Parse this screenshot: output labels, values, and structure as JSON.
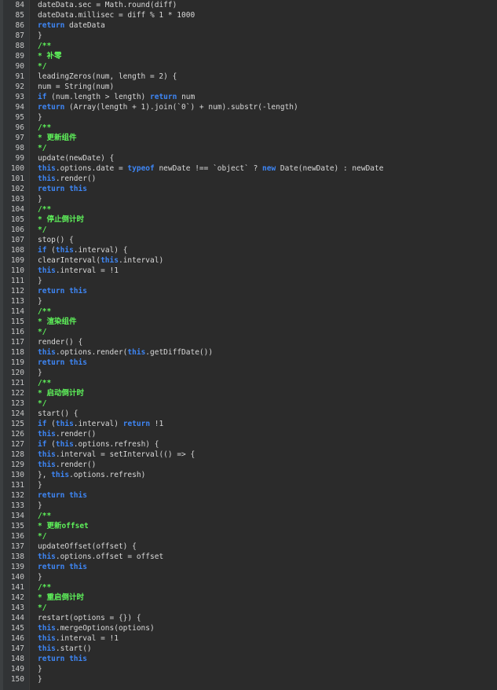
{
  "theme": {
    "background": "#2b2b2b",
    "gutter": "#313335",
    "keyword": "#3e86f5",
    "comment": "#5ef15a",
    "text": "#d9d9d9"
  },
  "lines": [
    {
      "n": "84",
      "tokens": [
        [
          "p",
          "dateData.sec = Math.round(diff)"
        ]
      ]
    },
    {
      "n": "85",
      "tokens": [
        [
          "p",
          "dateData.millisec = diff % 1 * 1000"
        ]
      ]
    },
    {
      "n": "86",
      "tokens": [
        [
          "k",
          "return"
        ],
        [
          "p",
          " dateData"
        ]
      ]
    },
    {
      "n": "87",
      "tokens": [
        [
          "p",
          "}"
        ]
      ]
    },
    {
      "n": "88",
      "tokens": [
        [
          "c",
          "/**"
        ]
      ]
    },
    {
      "n": "89",
      "tokens": [
        [
          "c",
          "* 补零"
        ]
      ]
    },
    {
      "n": "90",
      "tokens": [
        [
          "c",
          "*/"
        ]
      ]
    },
    {
      "n": "91",
      "tokens": [
        [
          "p",
          "leadingZeros(num, length = 2) {"
        ]
      ]
    },
    {
      "n": "92",
      "tokens": [
        [
          "p",
          "num = String(num)"
        ]
      ]
    },
    {
      "n": "93",
      "tokens": [
        [
          "k",
          "if"
        ],
        [
          "p",
          " (num.length > length) "
        ],
        [
          "k",
          "return"
        ],
        [
          "p",
          " num"
        ]
      ]
    },
    {
      "n": "94",
      "tokens": [
        [
          "k",
          "return"
        ],
        [
          "p",
          " (Array(length + 1).join(`0`) + num).substr(-length)"
        ]
      ]
    },
    {
      "n": "95",
      "tokens": [
        [
          "p",
          "}"
        ]
      ]
    },
    {
      "n": "96",
      "tokens": [
        [
          "c",
          "/**"
        ]
      ]
    },
    {
      "n": "97",
      "tokens": [
        [
          "c",
          "* 更新组件"
        ]
      ]
    },
    {
      "n": "98",
      "tokens": [
        [
          "c",
          "*/"
        ]
      ]
    },
    {
      "n": "99",
      "tokens": [
        [
          "p",
          "update(newDate) {"
        ]
      ]
    },
    {
      "n": "100",
      "tokens": [
        [
          "k",
          "this"
        ],
        [
          "p",
          ".options.date = "
        ],
        [
          "k",
          "typeof"
        ],
        [
          "p",
          " newDate !== `object` ? "
        ],
        [
          "k",
          "new"
        ],
        [
          "p",
          " Date(newDate) : newDate"
        ]
      ]
    },
    {
      "n": "101",
      "tokens": [
        [
          "k",
          "this"
        ],
        [
          "p",
          ".render()"
        ]
      ]
    },
    {
      "n": "102",
      "tokens": [
        [
          "k",
          "return"
        ],
        [
          "p",
          " "
        ],
        [
          "k",
          "this"
        ]
      ]
    },
    {
      "n": "103",
      "tokens": [
        [
          "p",
          "}"
        ]
      ]
    },
    {
      "n": "104",
      "tokens": [
        [
          "c",
          "/**"
        ]
      ]
    },
    {
      "n": "105",
      "tokens": [
        [
          "c",
          "* 停止倒计时"
        ]
      ]
    },
    {
      "n": "106",
      "tokens": [
        [
          "c",
          "*/"
        ]
      ]
    },
    {
      "n": "107",
      "tokens": [
        [
          "p",
          "stop() {"
        ]
      ]
    },
    {
      "n": "108",
      "tokens": [
        [
          "k",
          "if"
        ],
        [
          "p",
          " ("
        ],
        [
          "k",
          "this"
        ],
        [
          "p",
          ".interval) {"
        ]
      ]
    },
    {
      "n": "109",
      "tokens": [
        [
          "p",
          "clearInterval("
        ],
        [
          "k",
          "this"
        ],
        [
          "p",
          ".interval)"
        ]
      ]
    },
    {
      "n": "110",
      "tokens": [
        [
          "k",
          "this"
        ],
        [
          "p",
          ".interval = !1"
        ]
      ]
    },
    {
      "n": "111",
      "tokens": [
        [
          "p",
          "}"
        ]
      ]
    },
    {
      "n": "112",
      "tokens": [
        [
          "k",
          "return"
        ],
        [
          "p",
          " "
        ],
        [
          "k",
          "this"
        ]
      ]
    },
    {
      "n": "113",
      "tokens": [
        [
          "p",
          "}"
        ]
      ]
    },
    {
      "n": "114",
      "tokens": [
        [
          "c",
          "/**"
        ]
      ]
    },
    {
      "n": "115",
      "tokens": [
        [
          "c",
          "* 渲染组件"
        ]
      ]
    },
    {
      "n": "116",
      "tokens": [
        [
          "c",
          "*/"
        ]
      ]
    },
    {
      "n": "117",
      "tokens": [
        [
          "p",
          "render() {"
        ]
      ]
    },
    {
      "n": "118",
      "tokens": [
        [
          "k",
          "this"
        ],
        [
          "p",
          ".options.render("
        ],
        [
          "k",
          "this"
        ],
        [
          "p",
          ".getDiffDate())"
        ]
      ]
    },
    {
      "n": "119",
      "tokens": [
        [
          "k",
          "return"
        ],
        [
          "p",
          " "
        ],
        [
          "k",
          "this"
        ]
      ]
    },
    {
      "n": "120",
      "tokens": [
        [
          "p",
          "}"
        ]
      ]
    },
    {
      "n": "121",
      "tokens": [
        [
          "c",
          "/**"
        ]
      ]
    },
    {
      "n": "122",
      "tokens": [
        [
          "c",
          "* 启动倒计时"
        ]
      ]
    },
    {
      "n": "123",
      "tokens": [
        [
          "c",
          "*/"
        ]
      ]
    },
    {
      "n": "124",
      "tokens": [
        [
          "p",
          "start() {"
        ]
      ]
    },
    {
      "n": "125",
      "tokens": [
        [
          "k",
          "if"
        ],
        [
          "p",
          " ("
        ],
        [
          "k",
          "this"
        ],
        [
          "p",
          ".interval) "
        ],
        [
          "k",
          "return"
        ],
        [
          "p",
          " !1"
        ]
      ]
    },
    {
      "n": "126",
      "tokens": [
        [
          "k",
          "this"
        ],
        [
          "p",
          ".render()"
        ]
      ]
    },
    {
      "n": "127",
      "tokens": [
        [
          "k",
          "if"
        ],
        [
          "p",
          " ("
        ],
        [
          "k",
          "this"
        ],
        [
          "p",
          ".options.refresh) {"
        ]
      ]
    },
    {
      "n": "128",
      "tokens": [
        [
          "k",
          "this"
        ],
        [
          "p",
          ".interval = setInterval(() => {"
        ]
      ]
    },
    {
      "n": "129",
      "tokens": [
        [
          "k",
          "this"
        ],
        [
          "p",
          ".render()"
        ]
      ]
    },
    {
      "n": "130",
      "tokens": [
        [
          "p",
          "}, "
        ],
        [
          "k",
          "this"
        ],
        [
          "p",
          ".options.refresh)"
        ]
      ]
    },
    {
      "n": "131",
      "tokens": [
        [
          "p",
          "}"
        ]
      ]
    },
    {
      "n": "132",
      "tokens": [
        [
          "k",
          "return"
        ],
        [
          "p",
          " "
        ],
        [
          "k",
          "this"
        ]
      ]
    },
    {
      "n": "133",
      "tokens": [
        [
          "p",
          "}"
        ]
      ]
    },
    {
      "n": "134",
      "tokens": [
        [
          "c",
          "/**"
        ]
      ]
    },
    {
      "n": "135",
      "tokens": [
        [
          "c",
          "* 更新offset"
        ]
      ]
    },
    {
      "n": "136",
      "tokens": [
        [
          "c",
          "*/"
        ]
      ]
    },
    {
      "n": "137",
      "tokens": [
        [
          "p",
          "updateOffset(offset) {"
        ]
      ]
    },
    {
      "n": "138",
      "tokens": [
        [
          "k",
          "this"
        ],
        [
          "p",
          ".options.offset = offset"
        ]
      ]
    },
    {
      "n": "139",
      "tokens": [
        [
          "k",
          "return"
        ],
        [
          "p",
          " "
        ],
        [
          "k",
          "this"
        ]
      ]
    },
    {
      "n": "140",
      "tokens": [
        [
          "p",
          "}"
        ]
      ]
    },
    {
      "n": "141",
      "tokens": [
        [
          "c",
          "/**"
        ]
      ]
    },
    {
      "n": "142",
      "tokens": [
        [
          "c",
          "* 重启倒计时"
        ]
      ]
    },
    {
      "n": "143",
      "tokens": [
        [
          "c",
          "*/"
        ]
      ]
    },
    {
      "n": "144",
      "tokens": [
        [
          "p",
          "restart(options = {}) {"
        ]
      ]
    },
    {
      "n": "145",
      "tokens": [
        [
          "k",
          "this"
        ],
        [
          "p",
          ".mergeOptions(options)"
        ]
      ]
    },
    {
      "n": "146",
      "tokens": [
        [
          "k",
          "this"
        ],
        [
          "p",
          ".interval = !1"
        ]
      ]
    },
    {
      "n": "147",
      "tokens": [
        [
          "k",
          "this"
        ],
        [
          "p",
          ".start()"
        ]
      ]
    },
    {
      "n": "148",
      "tokens": [
        [
          "k",
          "return"
        ],
        [
          "p",
          " "
        ],
        [
          "k",
          "this"
        ]
      ]
    },
    {
      "n": "149",
      "tokens": [
        [
          "p",
          "}"
        ]
      ]
    },
    {
      "n": "150",
      "tokens": [
        [
          "p",
          "}"
        ]
      ]
    }
  ]
}
